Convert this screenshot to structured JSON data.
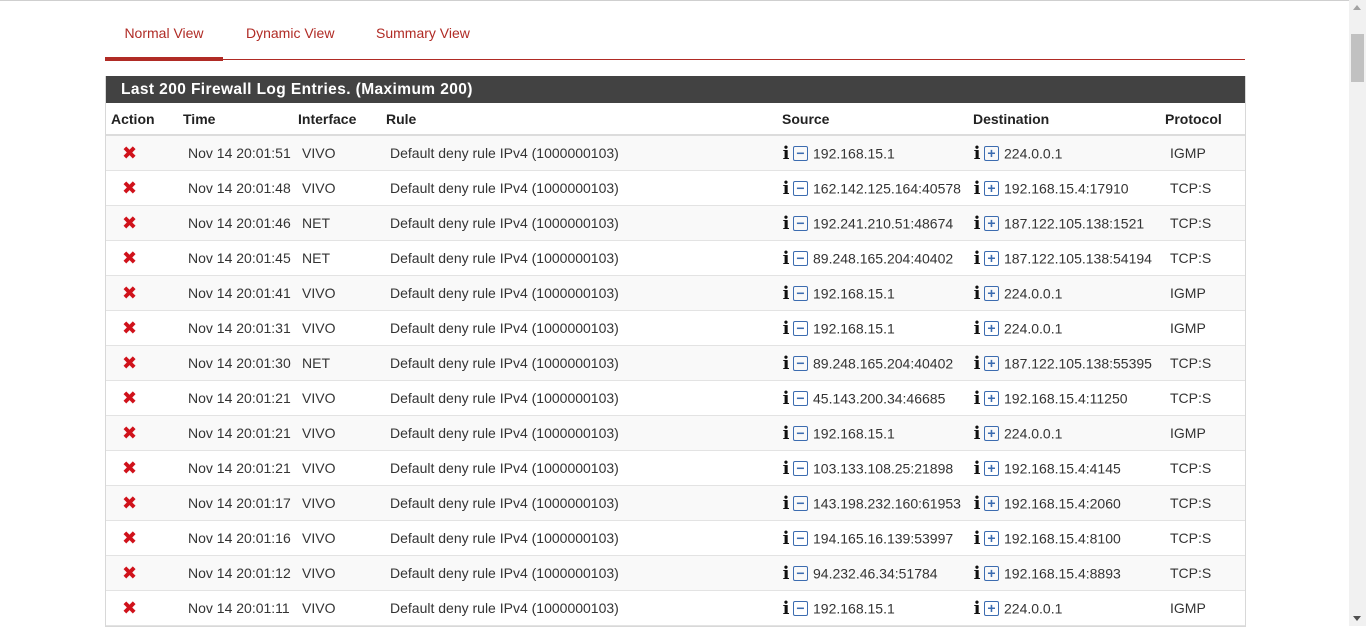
{
  "tabs": [
    {
      "label": "Normal View",
      "active": true
    },
    {
      "label": "Dynamic View",
      "active": false
    },
    {
      "label": "Summary View",
      "active": false
    }
  ],
  "panel": {
    "title": "Last 200 Firewall Log Entries. (Maximum 200)"
  },
  "table": {
    "headers": {
      "action": "Action",
      "time": "Time",
      "interface": "Interface",
      "rule": "Rule",
      "source": "Source",
      "destination": "Destination",
      "protocol": "Protocol"
    },
    "rows": [
      {
        "time": "Nov 14 20:01:51",
        "iface": "VIVO",
        "rule": "Default deny rule IPv4 (1000000103)",
        "src": "192.168.15.1",
        "dst": "224.0.0.1",
        "proto": "IGMP"
      },
      {
        "time": "Nov 14 20:01:48",
        "iface": "VIVO",
        "rule": "Default deny rule IPv4 (1000000103)",
        "src": "162.142.125.164:40578",
        "dst": "192.168.15.4:17910",
        "proto": "TCP:S"
      },
      {
        "time": "Nov 14 20:01:46",
        "iface": "NET",
        "rule": "Default deny rule IPv4 (1000000103)",
        "src": "192.241.210.51:48674",
        "dst": "187.122.105.138:1521",
        "proto": "TCP:S"
      },
      {
        "time": "Nov 14 20:01:45",
        "iface": "NET",
        "rule": "Default deny rule IPv4 (1000000103)",
        "src": "89.248.165.204:40402",
        "dst": "187.122.105.138:54194",
        "proto": "TCP:S"
      },
      {
        "time": "Nov 14 20:01:41",
        "iface": "VIVO",
        "rule": "Default deny rule IPv4 (1000000103)",
        "src": "192.168.15.1",
        "dst": "224.0.0.1",
        "proto": "IGMP"
      },
      {
        "time": "Nov 14 20:01:31",
        "iface": "VIVO",
        "rule": "Default deny rule IPv4 (1000000103)",
        "src": "192.168.15.1",
        "dst": "224.0.0.1",
        "proto": "IGMP"
      },
      {
        "time": "Nov 14 20:01:30",
        "iface": "NET",
        "rule": "Default deny rule IPv4 (1000000103)",
        "src": "89.248.165.204:40402",
        "dst": "187.122.105.138:55395",
        "proto": "TCP:S"
      },
      {
        "time": "Nov 14 20:01:21",
        "iface": "VIVO",
        "rule": "Default deny rule IPv4 (1000000103)",
        "src": "45.143.200.34:46685",
        "dst": "192.168.15.4:11250",
        "proto": "TCP:S"
      },
      {
        "time": "Nov 14 20:01:21",
        "iface": "VIVO",
        "rule": "Default deny rule IPv4 (1000000103)",
        "src": "192.168.15.1",
        "dst": "224.0.0.1",
        "proto": "IGMP"
      },
      {
        "time": "Nov 14 20:01:21",
        "iface": "VIVO",
        "rule": "Default deny rule IPv4 (1000000103)",
        "src": "103.133.108.25:21898",
        "dst": "192.168.15.4:4145",
        "proto": "TCP:S"
      },
      {
        "time": "Nov 14 20:01:17",
        "iface": "VIVO",
        "rule": "Default deny rule IPv4 (1000000103)",
        "src": "143.198.232.160:61953",
        "dst": "192.168.15.4:2060",
        "proto": "TCP:S"
      },
      {
        "time": "Nov 14 20:01:16",
        "iface": "VIVO",
        "rule": "Default deny rule IPv4 (1000000103)",
        "src": "194.165.16.139:53997",
        "dst": "192.168.15.4:8100",
        "proto": "TCP:S"
      },
      {
        "time": "Nov 14 20:01:12",
        "iface": "VIVO",
        "rule": "Default deny rule IPv4 (1000000103)",
        "src": "94.232.46.34:51784",
        "dst": "192.168.15.4:8893",
        "proto": "TCP:S"
      },
      {
        "time": "Nov 14 20:01:11",
        "iface": "VIVO",
        "rule": "Default deny rule IPv4 (1000000103)",
        "src": "192.168.15.1",
        "dst": "224.0.0.1",
        "proto": "IGMP"
      }
    ]
  },
  "icons": {
    "action_block": "close-icon",
    "info": "info-icon",
    "source_action": "minus-square-icon",
    "destination_action": "plus-square-icon"
  },
  "colors": {
    "accent": "#b02b25",
    "panel_heading": "#424242",
    "block_red": "#d0121b",
    "icon_blue": "#3c6cb0"
  }
}
